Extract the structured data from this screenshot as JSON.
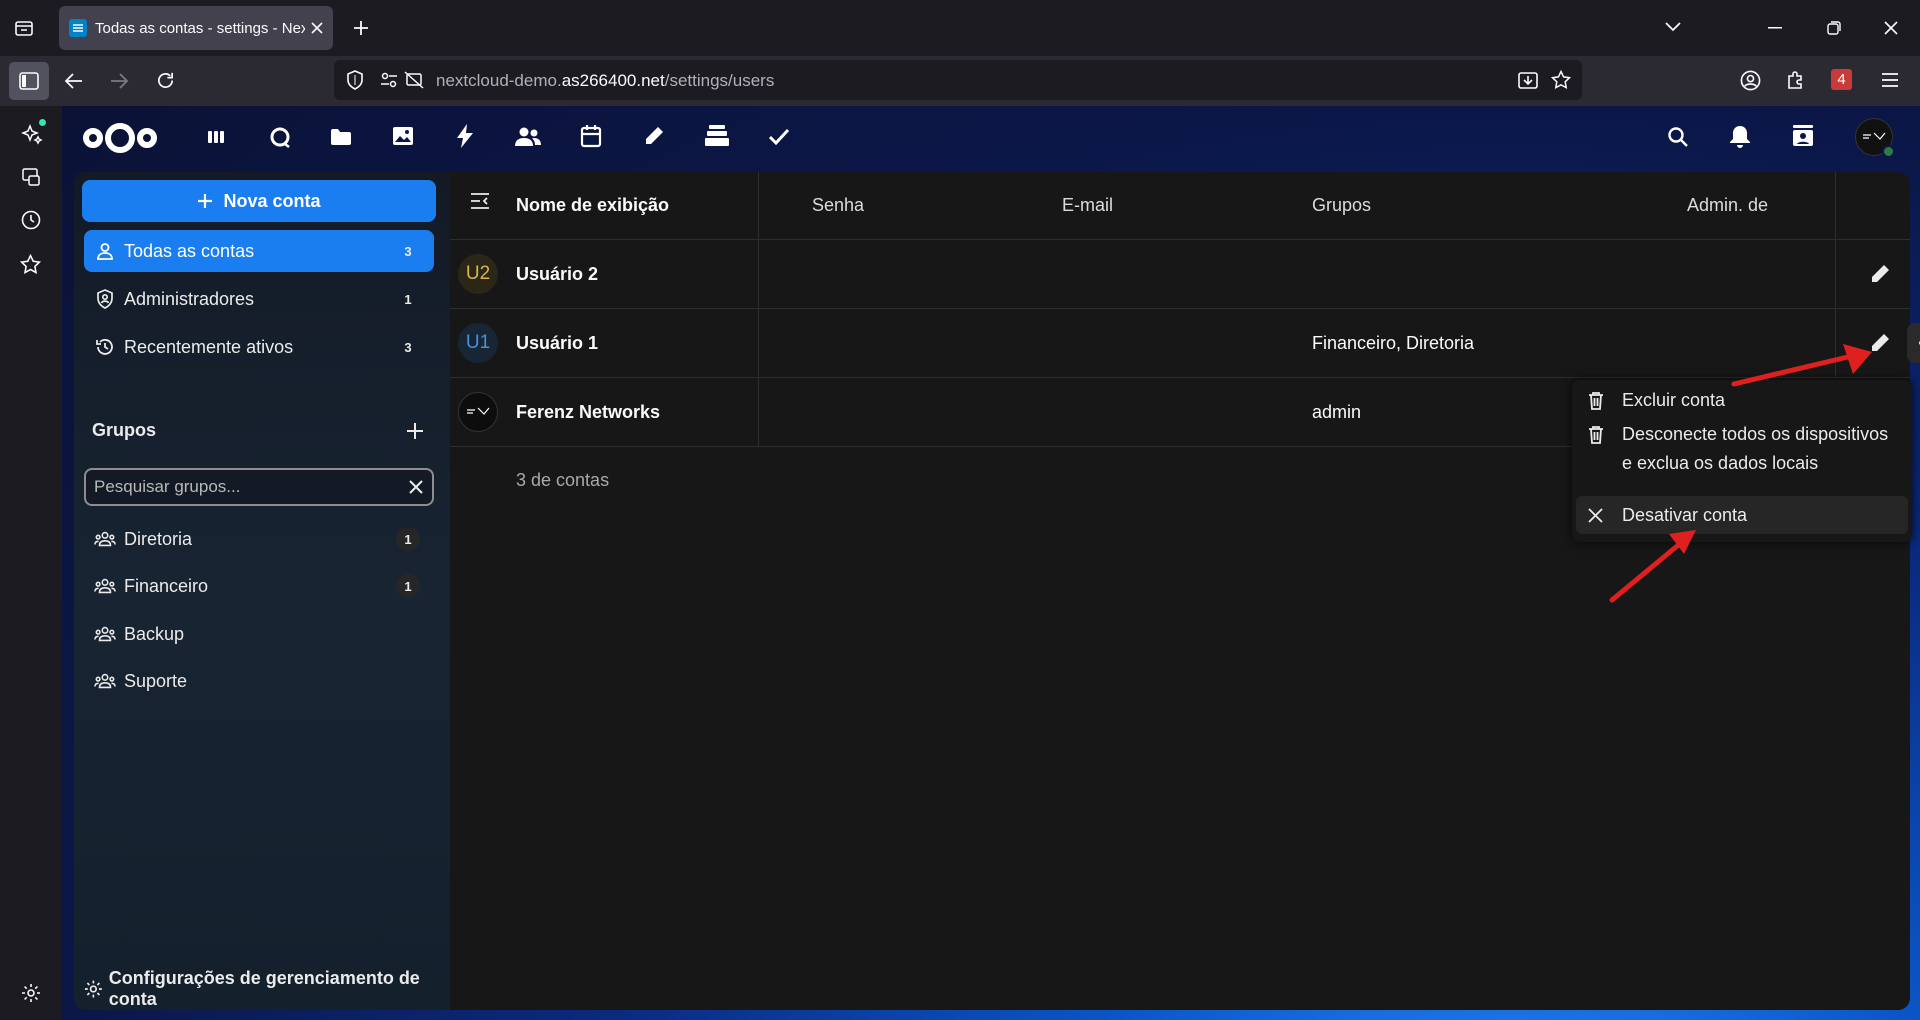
{
  "browser": {
    "tab_title": "Todas as contas - settings - Nextcloud",
    "url_prefix": "nextcloud-demo.",
    "url_domain": "as266400.net",
    "url_path": "/settings/users",
    "extension_badge": "4"
  },
  "nav": {
    "new_account": "Nova conta",
    "items": [
      {
        "label": "Todas as contas",
        "count": "3"
      },
      {
        "label": "Administradores",
        "count": "1"
      },
      {
        "label": "Recentemente ativos",
        "count": "3"
      }
    ],
    "groups_heading": "Grupos",
    "group_search_placeholder": "Pesquisar grupos...",
    "groups": [
      {
        "label": "Diretoria",
        "count": "1"
      },
      {
        "label": "Financeiro",
        "count": "1"
      },
      {
        "label": "Backup",
        "count": ""
      },
      {
        "label": "Suporte",
        "count": ""
      }
    ],
    "settings_label": "Configurações de gerenciamento de conta"
  },
  "table": {
    "headers": {
      "name": "Nome de exibição",
      "password": "Senha",
      "email": "E-mail",
      "groups": "Grupos",
      "admin": "Admin. de"
    },
    "rows": [
      {
        "initials": "U2",
        "name": "Usuário 2",
        "groups": ""
      },
      {
        "initials": "U1",
        "name": "Usuário 1",
        "groups": "Financeiro, Diretoria"
      },
      {
        "initials": "",
        "name": "Ferenz Networks",
        "groups": "admin"
      }
    ],
    "footer": "3 de contas"
  },
  "menu": {
    "delete": "Excluir conta",
    "wipe_line1": "Desconecte todos os dispositivos",
    "wipe_line2": "e exclua os dados locais",
    "disable": "Desativar conta"
  },
  "colors": {
    "primary": "#1a7ef0",
    "annotation_arrow": "#e0201e",
    "u2_initials": "#d9b44a",
    "u1_initials": "#4a90d9"
  }
}
